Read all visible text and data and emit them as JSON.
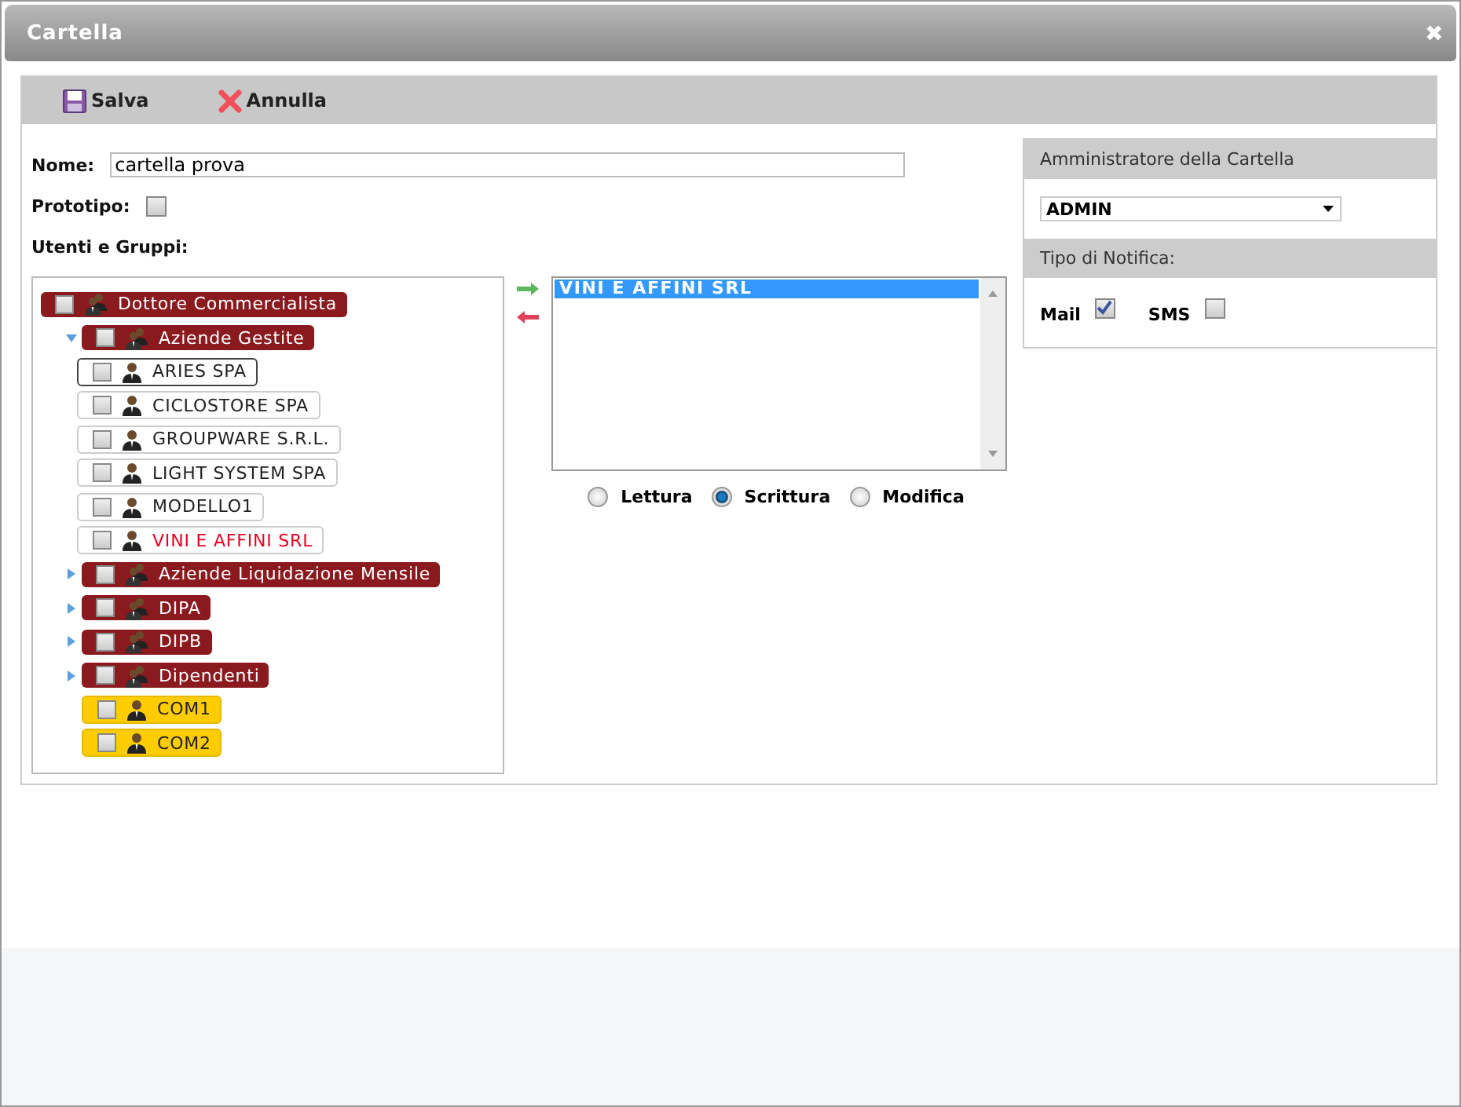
{
  "window": {
    "title": "Cartella",
    "close": "✖"
  },
  "toolbar": [
    {
      "label": "Salva",
      "kind": "save"
    },
    {
      "label": "Annulla",
      "kind": "cancel"
    }
  ],
  "form": {
    "name_label": "Nome:",
    "name_value": "cartella prova",
    "prototype_label": "Prototipo:",
    "prototype_checked": false,
    "users_label": "Utenti e Gruppi:"
  },
  "tree": [
    {
      "label": "Dottore Commercialista",
      "kind": "group",
      "checked": false,
      "selected": false,
      "children": [
        {
          "label": "Aziende Gestite",
          "kind": "group",
          "checked": false,
          "selected": false,
          "expanded": true,
          "children": [
            {
              "label": "ARIES SPA",
              "kind": "company",
              "checked": false,
              "selected": true,
              "assigned": false
            },
            {
              "label": "CICLOSTORE SPA",
              "kind": "company",
              "checked": false,
              "selected": false,
              "assigned": false
            },
            {
              "label": "GROUPWARE S.R.L.",
              "kind": "company",
              "checked": false,
              "selected": false,
              "assigned": false
            },
            {
              "label": "LIGHT SYSTEM SPA",
              "kind": "company",
              "checked": false,
              "selected": false,
              "assigned": false
            },
            {
              "label": "MODELLO1",
              "kind": "company",
              "checked": false,
              "selected": false,
              "assigned": false
            },
            {
              "label": "VINI E AFFINI SRL",
              "kind": "company",
              "checked": false,
              "selected": false,
              "assigned": true
            }
          ]
        },
        {
          "label": "Aziende Liquidazione Mensile",
          "kind": "group",
          "checked": false,
          "selected": false,
          "expanded": false
        },
        {
          "label": "DIPA",
          "kind": "group",
          "checked": false,
          "selected": false,
          "expanded": false
        },
        {
          "label": "DIPB",
          "kind": "group",
          "checked": false,
          "selected": false,
          "expanded": false
        },
        {
          "label": "Dipendenti",
          "kind": "group",
          "checked": false,
          "selected": false,
          "expanded": false
        },
        {
          "label": "COM1",
          "kind": "user",
          "checked": false,
          "selected": false
        },
        {
          "label": "COM2",
          "kind": "user",
          "checked": false,
          "selected": false
        }
      ]
    }
  ],
  "assigned_list": [
    {
      "label": "VINI E AFFINI SRL",
      "selected": true
    }
  ],
  "permissions": [
    {
      "label": "Lettura",
      "selected": false
    },
    {
      "label": "Scrittura",
      "selected": true
    },
    {
      "label": "Modifica",
      "selected": false
    }
  ],
  "admin": {
    "header": "Amministratore della Cartella",
    "value": "ADMIN"
  },
  "notification": {
    "header": "Tipo di Notifica:",
    "options": [
      {
        "label": "Mail",
        "checked": true
      },
      {
        "label": "SMS",
        "checked": false
      }
    ]
  }
}
